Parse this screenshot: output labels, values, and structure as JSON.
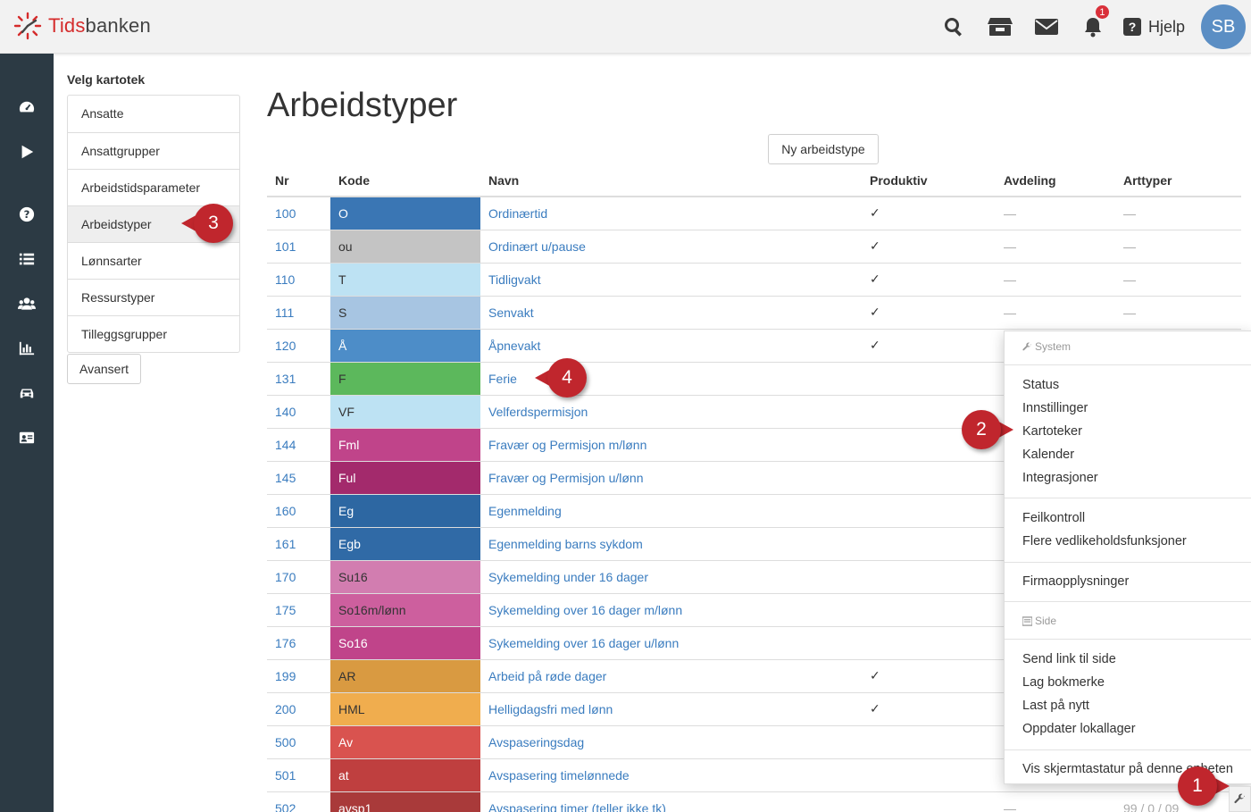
{
  "app": {
    "logo_text_accent": "Tids",
    "logo_text_rest": "banken"
  },
  "topbar": {
    "icons": [
      "search-icon",
      "store-icon",
      "mail-icon",
      "bell-icon"
    ],
    "notification_count": "1",
    "help_label": "Hjelp",
    "avatar_initials": "SB"
  },
  "sidebar": {
    "icons": [
      "dashboard-icon",
      "play-icon",
      "help-icon",
      "list-icon",
      "users-icon",
      "chart-icon",
      "car-icon",
      "id-card-icon"
    ]
  },
  "kartotek": {
    "title": "Velg kartotek",
    "items": [
      "Ansatte",
      "Ansattgrupper",
      "Arbeidstidsparameter",
      "Arbeidstyper",
      "Lønnsarter",
      "Ressurstyper",
      "Tilleggsgrupper"
    ],
    "active_index": 3,
    "advanced_button": "Avansert"
  },
  "main": {
    "title": "Arbeidstyper",
    "new_button": "Ny arbeidstype",
    "columns": [
      "Nr",
      "Kode",
      "Navn",
      "Produktiv",
      "Avdeling",
      "Arttyper"
    ],
    "rows": [
      {
        "nr": "100",
        "kode": "O",
        "color": "#3a76b4",
        "text_color": "#ffffff",
        "navn": "Ordinærtid",
        "produktiv": "✓",
        "avdeling": "—",
        "arttyper": "—"
      },
      {
        "nr": "101",
        "kode": "ou",
        "color": "#c4c4c4",
        "text_color": "#333333",
        "navn": "Ordinært u/pause",
        "produktiv": "✓",
        "avdeling": "—",
        "arttyper": "—"
      },
      {
        "nr": "110",
        "kode": "T",
        "color": "#bde2f3",
        "text_color": "#333333",
        "navn": "Tidligvakt",
        "produktiv": "✓",
        "avdeling": "—",
        "arttyper": "—"
      },
      {
        "nr": "111",
        "kode": "S",
        "color": "#a7c5e2",
        "text_color": "#333333",
        "navn": "Senvakt",
        "produktiv": "✓",
        "avdeling": "—",
        "arttyper": "—"
      },
      {
        "nr": "120",
        "kode": "Å",
        "color": "#4d8dc8",
        "text_color": "#ffffff",
        "navn": "Åpnevakt",
        "produktiv": "✓",
        "avdeling": "",
        "arttyper": ""
      },
      {
        "nr": "131",
        "kode": "F",
        "color": "#5cb85c",
        "text_color": "#333333",
        "navn": "Ferie",
        "produktiv": "",
        "avdeling": "",
        "arttyper": ""
      },
      {
        "nr": "140",
        "kode": "VF",
        "color": "#bde2f3",
        "text_color": "#333333",
        "navn": "Velferdspermisjon",
        "produktiv": "",
        "avdeling": "",
        "arttyper": ""
      },
      {
        "nr": "144",
        "kode": "Fml",
        "color": "#c0448a",
        "text_color": "#ffffff",
        "navn": "Fravær og Permisjon m/lønn",
        "produktiv": "",
        "avdeling": "",
        "arttyper": ""
      },
      {
        "nr": "145",
        "kode": "Ful",
        "color": "#a32a6c",
        "text_color": "#ffffff",
        "navn": "Fravær og Permisjon u/lønn",
        "produktiv": "",
        "avdeling": "",
        "arttyper": ""
      },
      {
        "nr": "160",
        "kode": "Eg",
        "color": "#2d67a2",
        "text_color": "#ffffff",
        "navn": "Egenmelding",
        "produktiv": "",
        "avdeling": "",
        "arttyper": ""
      },
      {
        "nr": "161",
        "kode": "Egb",
        "color": "#306aa6",
        "text_color": "#ffffff",
        "navn": "Egenmelding barns sykdom",
        "produktiv": "",
        "avdeling": "",
        "arttyper": ""
      },
      {
        "nr": "170",
        "kode": "Su16",
        "color": "#d27db0",
        "text_color": "#333333",
        "navn": "Sykemelding under 16 dager",
        "produktiv": "",
        "avdeling": "",
        "arttyper": ""
      },
      {
        "nr": "175",
        "kode": "So16m/lønn",
        "color": "#cd5f9e",
        "text_color": "#333333",
        "navn": "Sykemelding over 16 dager m/lønn",
        "produktiv": "",
        "avdeling": "",
        "arttyper": ""
      },
      {
        "nr": "176",
        "kode": "So16",
        "color": "#c0448a",
        "text_color": "#ffffff",
        "navn": "Sykemelding over 16 dager u/lønn",
        "produktiv": "",
        "avdeling": "",
        "arttyper": ""
      },
      {
        "nr": "199",
        "kode": "AR",
        "color": "#d99a41",
        "text_color": "#333333",
        "navn": "Arbeid på røde dager",
        "produktiv": "✓",
        "avdeling": "",
        "arttyper": ""
      },
      {
        "nr": "200",
        "kode": "HML",
        "color": "#f0ad4e",
        "text_color": "#333333",
        "navn": "Helligdagsfri med lønn",
        "produktiv": "✓",
        "avdeling": "",
        "arttyper": ""
      },
      {
        "nr": "500",
        "kode": "Av",
        "color": "#d9534f",
        "text_color": "#ffffff",
        "navn": "Avspaseringsdag",
        "produktiv": "",
        "avdeling": "",
        "arttyper": ""
      },
      {
        "nr": "501",
        "kode": "at",
        "color": "#bf3f3f",
        "text_color": "#ffffff",
        "navn": "Avspasering timelønnede",
        "produktiv": "",
        "avdeling": "",
        "arttyper": ""
      },
      {
        "nr": "502",
        "kode": "avsp1",
        "color": "#a93a3a",
        "text_color": "#ffffff",
        "navn": "Avspasering timer (teller ikke tk)",
        "produktiv": "",
        "avdeling": "—",
        "arttyper": "99 / 0 / 09"
      }
    ]
  },
  "menu": {
    "system_header": "System",
    "system_items": [
      "Status",
      "Innstillinger",
      "Kartoteker",
      "Kalender",
      "Integrasjoner"
    ],
    "maintenance_items": [
      "Feilkontroll",
      "Flere vedlikeholdsfunksjoner"
    ],
    "company_items": [
      "Firmaopplysninger"
    ],
    "side_header": "Side",
    "side_items": [
      "Send link til side",
      "Lag bokmerke",
      "Last på nytt",
      "Oppdater lokallager"
    ],
    "keyboard_item": "Vis skjermtastatur på denne enheten"
  },
  "callouts": [
    "1",
    "2",
    "3",
    "4"
  ]
}
